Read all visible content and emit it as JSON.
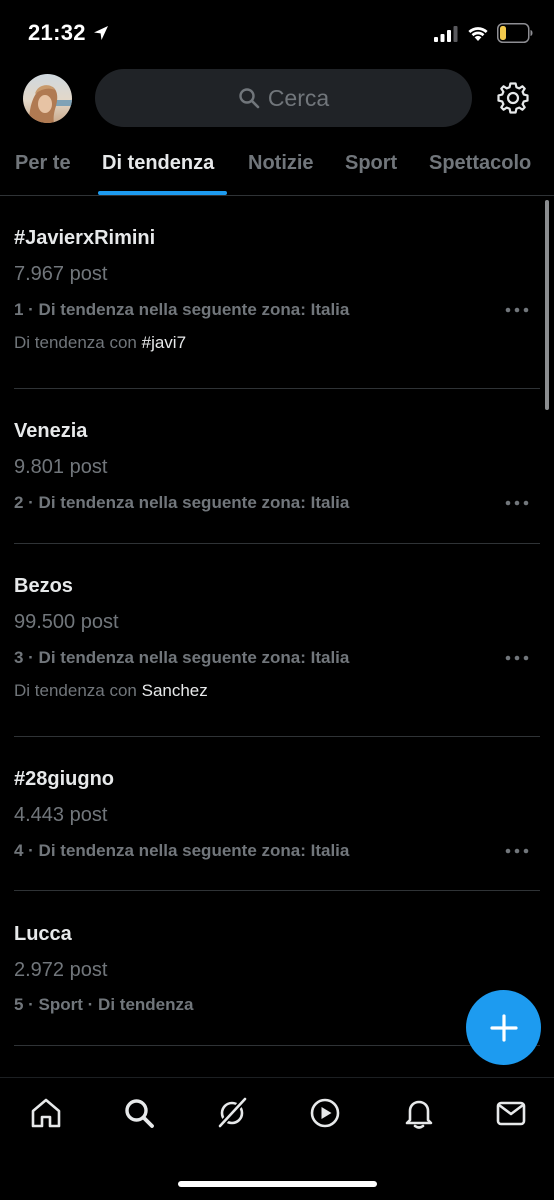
{
  "status_bar": {
    "time": "21:32"
  },
  "header": {
    "search_placeholder": "Cerca"
  },
  "tabs": [
    {
      "label": "Per te"
    },
    {
      "label": "Di tendenza",
      "active": true
    },
    {
      "label": "Notizie"
    },
    {
      "label": "Sport"
    },
    {
      "label": "Spettacolo"
    }
  ],
  "trends": [
    {
      "title": "#JavierxRimini",
      "count": "7.967 post",
      "meta": "1 · Di tendenza nella seguente zona: Italia",
      "with_prefix": "Di tendenza con",
      "with_tag": "#javi7"
    },
    {
      "title": "Venezia",
      "count": "9.801 post",
      "meta": "2 · Di tendenza nella seguente zona: Italia"
    },
    {
      "title": "Bezos",
      "count": "99.500 post",
      "meta": "3 · Di tendenza nella seguente zona: Italia",
      "with_prefix": "Di tendenza con",
      "with_tag": "Sanchez"
    },
    {
      "title": "#28giugno",
      "count": "4.443 post",
      "meta": "4 · Di tendenza nella seguente zona: Italia"
    },
    {
      "title": "Lucca",
      "count": "2.972 post",
      "meta": "5 · Sport · Di tendenza"
    }
  ],
  "bottom_nav": [
    "home-icon",
    "search-icon",
    "grok-icon",
    "video-icon",
    "bell-icon",
    "mail-icon"
  ],
  "colors": {
    "background": "#000000",
    "accent": "#1d9bf0",
    "text_primary": "#e7e9ea",
    "text_secondary": "#71767b",
    "search_bg": "#202327",
    "divider": "#2f3336",
    "battery_fill": "#f2c94c"
  }
}
